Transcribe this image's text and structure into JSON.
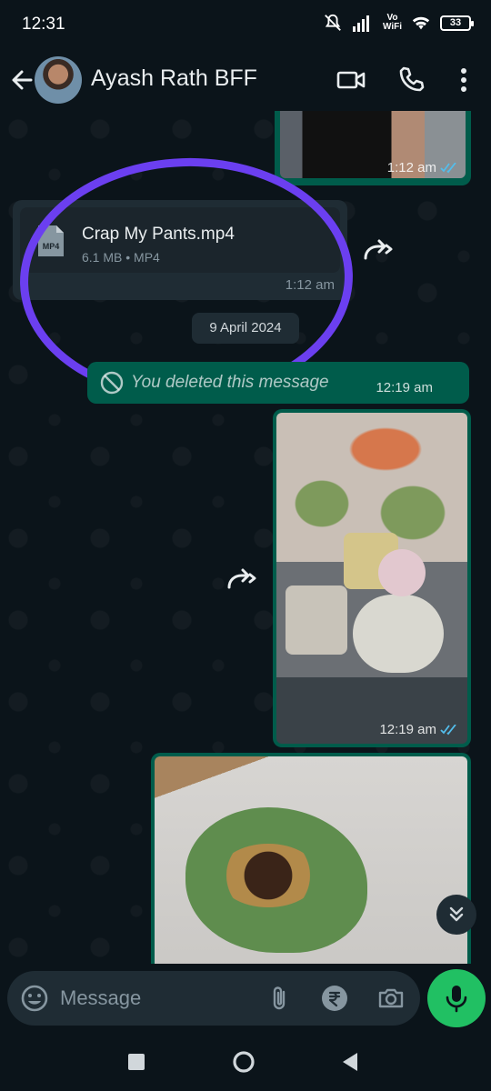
{
  "status_bar": {
    "time": "12:31",
    "vowifi_top": "Vo",
    "vowifi_bottom": "WiFi",
    "battery": "33"
  },
  "header": {
    "contact_name": "Ayash Rath BFF"
  },
  "messages": {
    "top_image_time": "1:12 am",
    "document": {
      "file_name": "Crap My Pants.mp4",
      "meta": "6.1 MB • MP4",
      "type_badge": "MP4",
      "time": "1:12 am"
    },
    "date_separator": "9 April 2024",
    "deleted": {
      "text": "You deleted this message",
      "time": "12:19 am"
    },
    "photo_time": "12:19 am"
  },
  "composer": {
    "placeholder": "Message"
  },
  "icons": [
    "back-arrow-icon",
    "video-call-icon",
    "voice-call-icon",
    "more-options-icon",
    "forward-icon",
    "document-icon",
    "deleted-icon",
    "double-check-icon",
    "scroll-down-icon",
    "emoji-icon",
    "attach-icon",
    "rupee-icon",
    "camera-icon",
    "mic-icon"
  ],
  "colors": {
    "background": "#0b141a",
    "outgoing_bubble": "#005c4b",
    "incoming_bubble": "#1f2c34",
    "accent_green": "#21c063",
    "read_tick": "#53bdeb",
    "annotation_circle": "#6b3ff0"
  }
}
